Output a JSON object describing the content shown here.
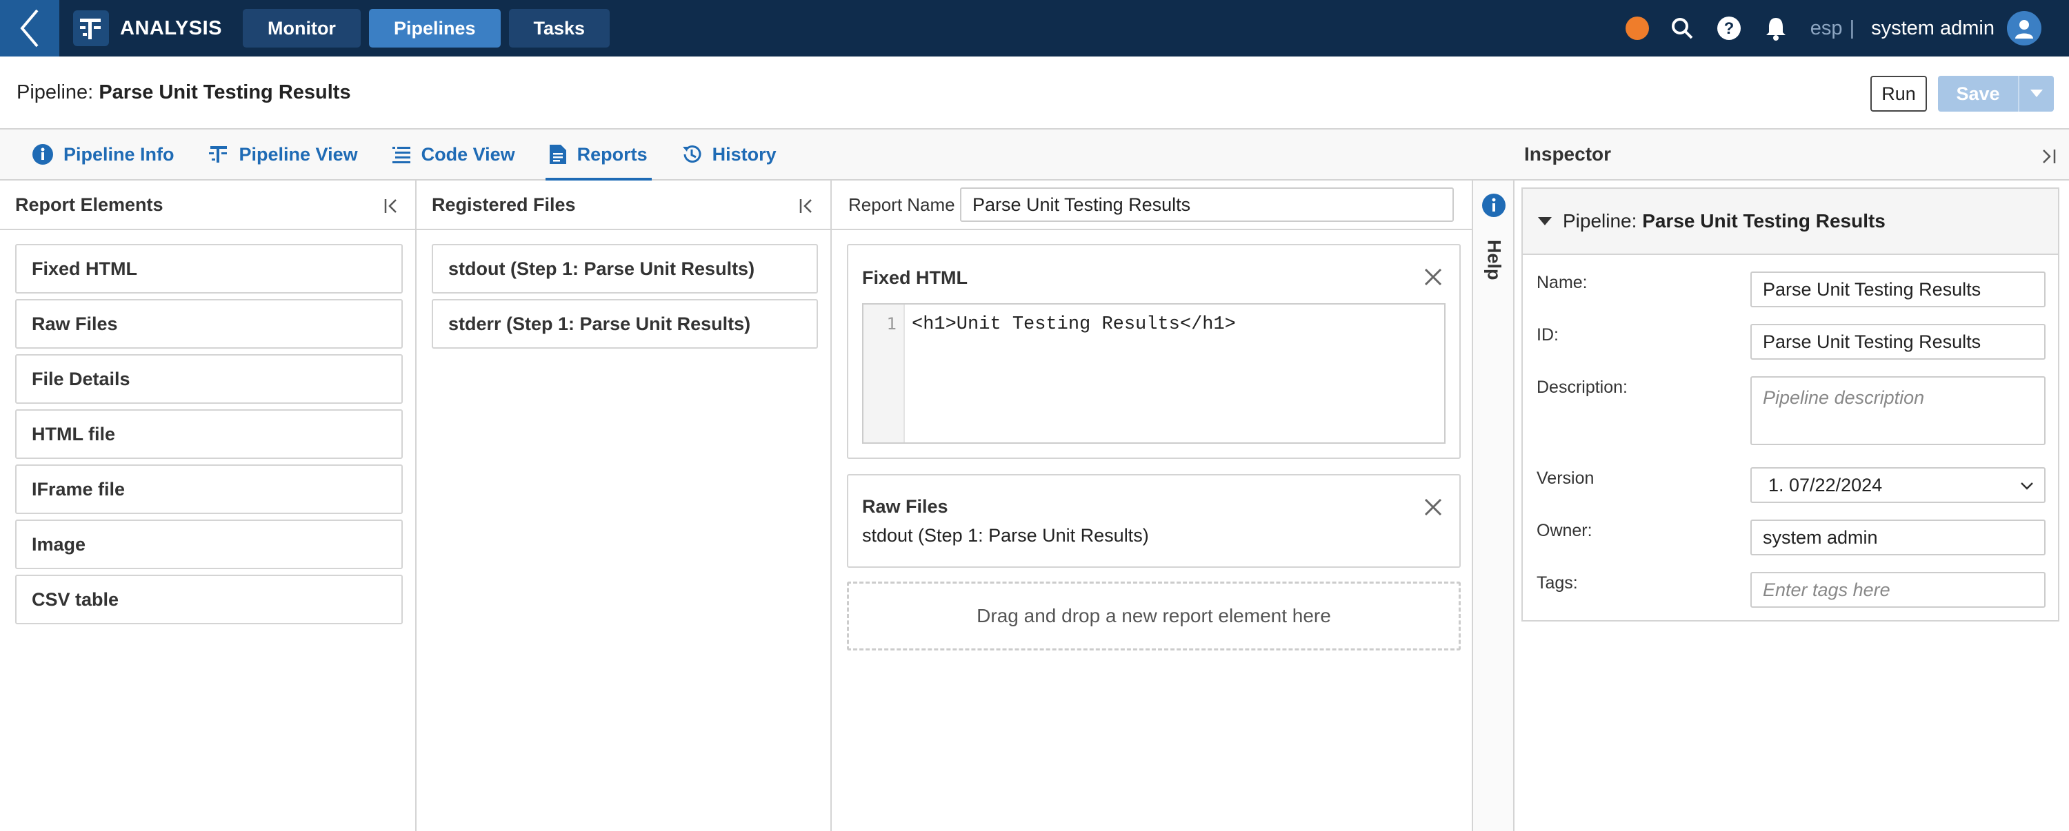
{
  "topbar": {
    "brand": "ANALYSIS",
    "nav": [
      {
        "label": "Monitor",
        "active": false
      },
      {
        "label": "Pipelines",
        "active": true
      },
      {
        "label": "Tasks",
        "active": false
      }
    ],
    "status_color": "#ef7d2b",
    "lang": "esp",
    "separator": "|",
    "user": "system admin"
  },
  "header": {
    "prefix": "Pipeline:",
    "name": "Parse Unit Testing Results",
    "run_label": "Run",
    "save_label": "Save"
  },
  "subtabs": [
    {
      "label": "Pipeline Info",
      "icon": "info-icon"
    },
    {
      "label": "Pipeline View",
      "icon": "pipeline-view-icon"
    },
    {
      "label": "Code View",
      "icon": "code-view-icon"
    },
    {
      "label": "Reports",
      "icon": "document-icon",
      "active": true
    },
    {
      "label": "History",
      "icon": "history-icon"
    }
  ],
  "report_elements": {
    "title": "Report Elements",
    "items": [
      "Fixed HTML",
      "Raw Files",
      "File Details",
      "HTML file",
      "IFrame file",
      "Image",
      "CSV table"
    ]
  },
  "registered_files": {
    "title": "Registered Files",
    "items": [
      "stdout (Step 1: Parse Unit Results)",
      "stderr (Step 1: Parse Unit Results)"
    ]
  },
  "report": {
    "name_label": "Report Name",
    "name_value": "Parse Unit Testing Results",
    "fixed_html": {
      "title": "Fixed HTML",
      "line_no": "1",
      "code": "<h1>Unit Testing Results</h1>"
    },
    "raw_files": {
      "title": "Raw Files",
      "file": "stdout (Step 1: Parse Unit Results)"
    },
    "drop_hint": "Drag and drop a new report element here"
  },
  "help": {
    "label": "Help"
  },
  "inspector": {
    "title": "Inspector",
    "section_prefix": "Pipeline:",
    "section_name": "Parse Unit Testing Results",
    "fields": {
      "name_label": "Name:",
      "name_value": "Parse Unit Testing Results",
      "id_label": "ID:",
      "id_value": "Parse Unit Testing Results",
      "description_label": "Description:",
      "description_placeholder": "Pipeline description",
      "version_label": "Version",
      "version_value": "1. 07/22/2024",
      "owner_label": "Owner:",
      "owner_value": "system admin",
      "tags_label": "Tags:",
      "tags_placeholder": "Enter tags here"
    }
  },
  "colors": {
    "topbar_bg": "#0f2c4c",
    "accent": "#1f6bb5",
    "active_nav": "#3b7fc4",
    "save_disabled": "#a8c6e6"
  }
}
